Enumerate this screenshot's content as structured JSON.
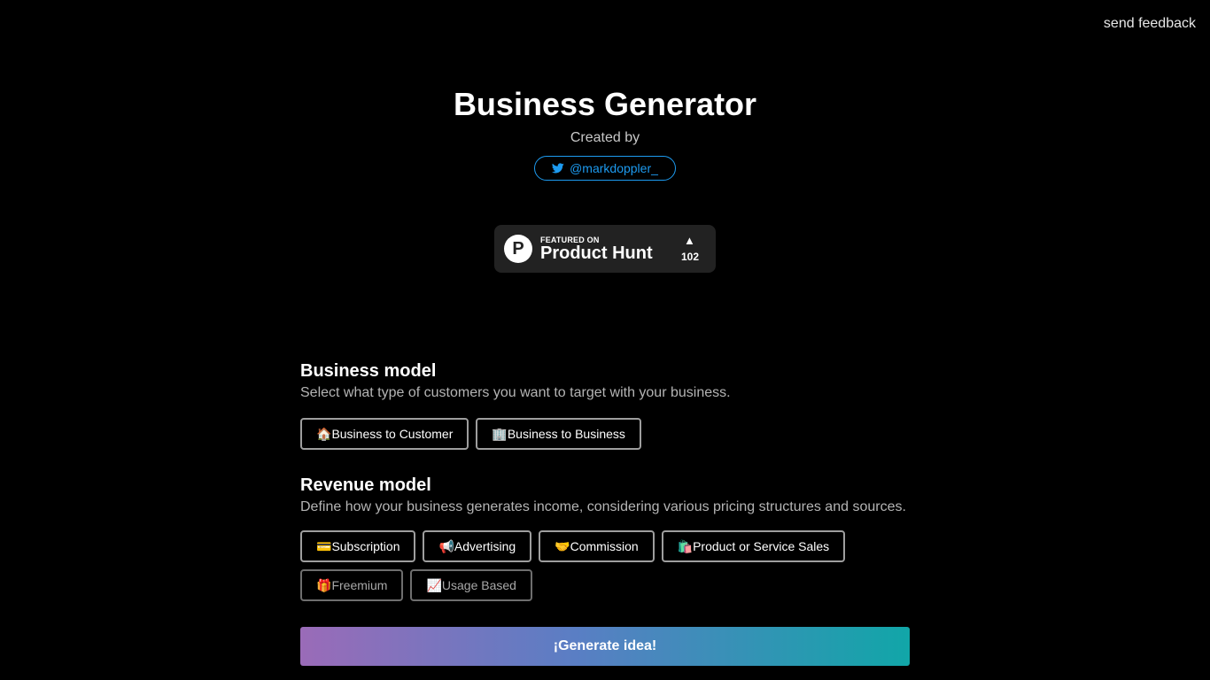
{
  "header": {
    "feedback_label": "send feedback"
  },
  "hero": {
    "title": "Business Generator",
    "created_by": "Created by",
    "twitter_handle": "@markdoppler_"
  },
  "product_hunt": {
    "featured_label": "FEATURED ON",
    "name": "Product Hunt",
    "logo_letter": "P",
    "upvote_arrow": "▲",
    "upvotes": "102"
  },
  "business_model": {
    "title": "Business model",
    "description": "Select what type of customers you want to target with your business.",
    "options": [
      {
        "icon": "🏠",
        "label": "Business to Customer"
      },
      {
        "icon": "🏢",
        "label": "Business to Business"
      }
    ]
  },
  "revenue_model": {
    "title": "Revenue model",
    "description": "Define how your business generates income, considering various pricing structures and sources.",
    "options": [
      {
        "icon": "💳",
        "label": "Subscription"
      },
      {
        "icon": "📢",
        "label": "Advertising"
      },
      {
        "icon": "🤝",
        "label": "Commission"
      },
      {
        "icon": "🛍️",
        "label": "Product or Service Sales"
      },
      {
        "icon": "🎁",
        "label": "Freemium"
      },
      {
        "icon": "📈",
        "label": "Usage Based"
      }
    ]
  },
  "generate": {
    "label": "¡Generate idea!"
  },
  "colors": {
    "background": "#000000",
    "twitter_blue": "#1d9bf0",
    "badge_bg": "#222222",
    "gradient_start": "#9a6bb8",
    "gradient_end": "#11a6a8"
  }
}
